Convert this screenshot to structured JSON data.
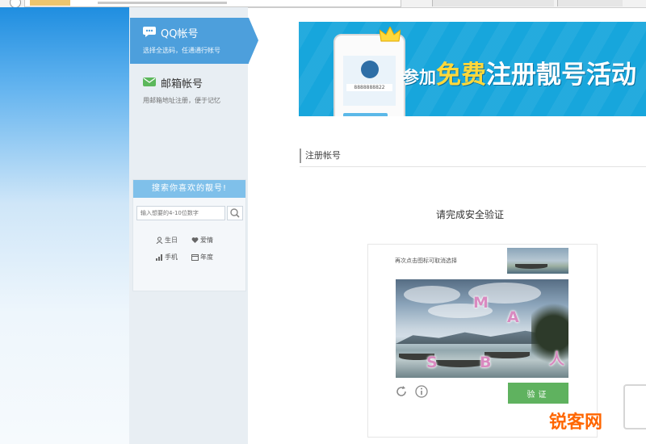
{
  "nav": {
    "qq": {
      "title": "QQ帐号",
      "subtitle": "选择全选码，任通通行帐号"
    },
    "mail": {
      "title": "邮箱帐号",
      "subtitle": "用邮箱地址注册，便于记忆"
    }
  },
  "search": {
    "title": "搜索你喜欢的靓号!",
    "placeholder": "输入想要的4-10位数字",
    "categories": [
      "生日",
      "爱情",
      "手机",
      "年度"
    ]
  },
  "banner": {
    "text_pre": "参加",
    "text_hl": "免费",
    "text_post": "注册靓号活动",
    "phone_number": "8888888822"
  },
  "section": {
    "title": "注册帐号"
  },
  "verify": {
    "heading": "请完成安全验证",
    "hint": "再次点击图标可取消选择",
    "button_label": "验证",
    "glyphs": [
      "M",
      "A",
      "S",
      "B",
      "人"
    ]
  },
  "watermark": {
    "brand": "锐客网"
  },
  "colors": {
    "accent": "#4d9fdc",
    "verify_button": "#5fb25f",
    "banner": "#17a6dc"
  }
}
